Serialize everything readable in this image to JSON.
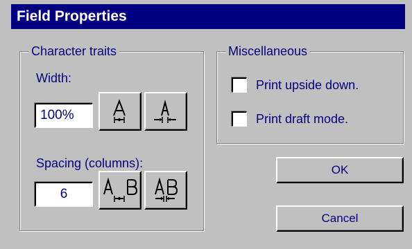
{
  "dialog": {
    "title": "Field Properties"
  },
  "character_traits": {
    "legend": "Character traits",
    "width_label": "Width:",
    "width_value": "100%",
    "width_buttons": [
      "widen-text-icon",
      "narrow-text-icon"
    ],
    "spacing_label": "Spacing (columns):",
    "spacing_value": "6",
    "spacing_buttons": [
      "increase-spacing-icon",
      "decrease-spacing-icon"
    ]
  },
  "miscellaneous": {
    "legend": "Miscellaneous",
    "print_upside_down": {
      "label": "Print upside down.",
      "checked": false
    },
    "print_draft_mode": {
      "label": "Print draft mode.",
      "checked": false
    }
  },
  "buttons": {
    "ok": "OK",
    "cancel": "Cancel"
  },
  "colors": {
    "title_bar": "#000080",
    "text": "#000080",
    "face": "#c0c0c0"
  }
}
